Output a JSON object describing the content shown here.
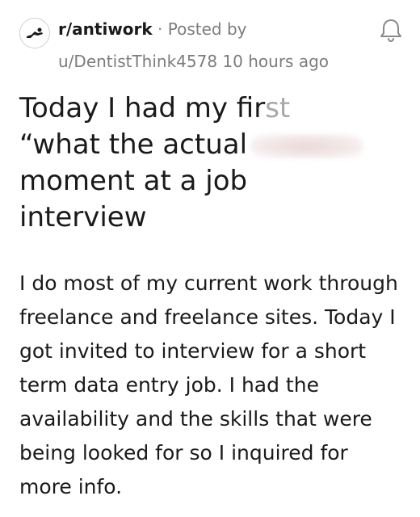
{
  "post": {
    "subreddit": "r/antiwork",
    "separator": " · ",
    "posted_by_label": "Posted by",
    "author": "u/DentistThink4578",
    "time_ago": "10 hours ago",
    "title_part1": "Today I had my fir",
    "title_part1_fade": "st",
    "title_part2": "“what the actual",
    "title_part3": "moment at a job",
    "title_part4": "interview",
    "body": "I do most of my current work through freelance and freelance sites. Today I got invited to interview for a short term data entry job. I had the availability and the skills that were being looked for so I inquired for more info."
  },
  "icons": {
    "subreddit_avatar": "antiwork-logo-icon",
    "notification": "bell-icon"
  }
}
